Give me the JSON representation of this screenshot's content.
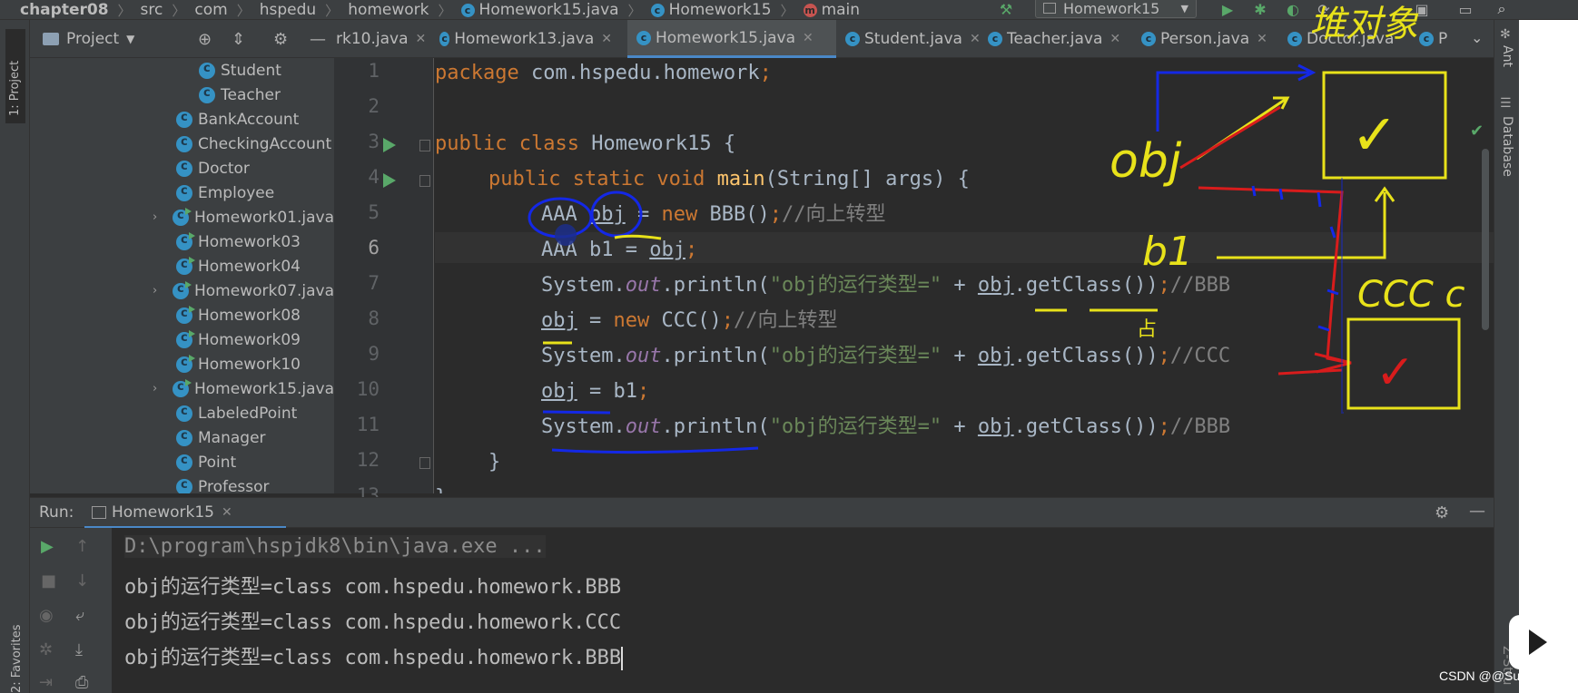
{
  "breadcrumb": {
    "items": [
      "chapter08",
      "src",
      "com",
      "hspedu",
      "homework"
    ],
    "file": "Homework15.java",
    "class": "Homework15",
    "method": "main"
  },
  "toolbar": {
    "run_config": "Homework15"
  },
  "left_stripe": {
    "project": "1: Project",
    "favorites": "2: Favorites"
  },
  "right_stripe": {
    "ant": "Ant",
    "database": "Database",
    "extra": "Z-Stru"
  },
  "project_panel": {
    "title": "Project",
    "items": [
      {
        "label": "Student",
        "expandable": false
      },
      {
        "label": "Teacher",
        "expandable": false
      },
      {
        "label": "BankAccount",
        "expandable": false
      },
      {
        "label": "CheckingAccount",
        "expandable": false
      },
      {
        "label": "Doctor",
        "expandable": false
      },
      {
        "label": "Employee",
        "expandable": false
      },
      {
        "label": "Homework01.java",
        "expandable": true
      },
      {
        "label": "Homework03",
        "expandable": false
      },
      {
        "label": "Homework04",
        "expandable": false
      },
      {
        "label": "Homework07.java",
        "expandable": true
      },
      {
        "label": "Homework08",
        "expandable": false
      },
      {
        "label": "Homework09",
        "expandable": false
      },
      {
        "label": "Homework10",
        "expandable": false
      },
      {
        "label": "Homework15.java",
        "expandable": true
      },
      {
        "label": "LabeledPoint",
        "expandable": false
      },
      {
        "label": "Manager",
        "expandable": false
      },
      {
        "label": "Point",
        "expandable": false
      },
      {
        "label": "Professor",
        "expandable": false
      }
    ]
  },
  "editor_tabs": [
    {
      "label": "rk10.java",
      "active": false
    },
    {
      "label": "Homework13.java",
      "active": false
    },
    {
      "label": "Homework15.java",
      "active": true
    },
    {
      "label": "Student.java",
      "active": false
    },
    {
      "label": "Teacher.java",
      "active": false
    },
    {
      "label": "Person.java",
      "active": false
    },
    {
      "label": "Doctor.java",
      "active": false
    },
    {
      "label": "P",
      "active": false
    }
  ],
  "editor": {
    "current_line": 6,
    "line_numbers": [
      "1",
      "2",
      "3",
      "4",
      "5",
      "6",
      "7",
      "8",
      "9",
      "10",
      "11",
      "12",
      "13"
    ],
    "tokens": {
      "l1_kw": "package",
      "l1_rest": " com.hspedu.homework",
      "semi": ";",
      "l3_kw": "public class",
      "l3_rest": " Homework15 {",
      "l4_kw": "public static void",
      "l4_fn": "main",
      "l4_rest": "(String[] args) {",
      "l5_a": "AAA ",
      "l5_obj": "obj",
      "l5_b": " = ",
      "l5_new": "new",
      "l5_c": " BBB()",
      "l5_cm": "//向上转型",
      "l6_a": "AAA b1 = ",
      "l6_obj": "obj",
      "sys": "System.",
      "out": "out",
      "println": ".println(",
      "str": "\"obj的运行类型=\"",
      "plus": " + ",
      "obj": "obj",
      "getClass": ".getClass())",
      "cm_bbb": "//BBB",
      "cm_ccc": "//CCC",
      "l8_b": " = ",
      "l8_new": "new",
      "l8_c": " CCC()",
      "l8_cm": "//向上转型",
      "l10_b": " = b1",
      "brace": "}"
    }
  },
  "run_panel": {
    "label": "Run:",
    "tab": "Homework15",
    "command": "D:\\program\\hspjdk8\\bin\\java.exe ...",
    "output": [
      "obj的运行类型=class com.hspedu.homework.BBB",
      "obj的运行类型=class com.hspedu.homework.CCC",
      "obj的运行类型=class com.hspedu.homework.BBB"
    ]
  },
  "handwriting": {
    "heap_label": "堆对象",
    "obj_label": "obj",
    "b1_label": "b1",
    "ccc_label": "CCC c",
    "sign": "✓"
  },
  "watermark": "CSDN @@Sunset...",
  "colors": {
    "keyword": "#cc7832",
    "function": "#ffc66d",
    "string": "#6a8759",
    "comment": "#808080",
    "static_field": "#9876aa",
    "accent": "#4a88c7"
  }
}
